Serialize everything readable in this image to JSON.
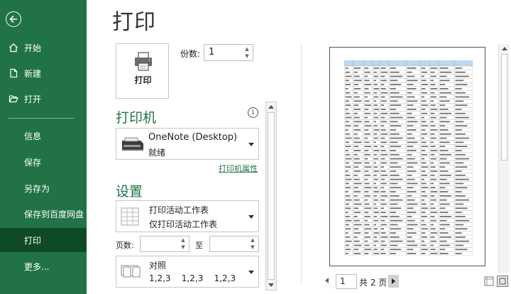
{
  "sidebar": {
    "items": [
      {
        "label": "开始",
        "icon": "home-icon"
      },
      {
        "label": "新建",
        "icon": "new-document-icon"
      },
      {
        "label": "打开",
        "icon": "folder-open-icon"
      },
      {
        "label": "信息"
      },
      {
        "label": "保存"
      },
      {
        "label": "另存为"
      },
      {
        "label": "保存到百度网盘"
      },
      {
        "label": "打印",
        "active": true
      },
      {
        "label": "更多..."
      }
    ]
  },
  "main": {
    "title": "打印",
    "print_button": {
      "label": "打印",
      "icon": "printer-icon"
    },
    "copies": {
      "label": "份数:",
      "value": "1"
    },
    "printer_section": {
      "heading": "打印机",
      "name": "OneNote (Desktop)",
      "status": "就绪",
      "properties_link": "打印机属性"
    },
    "settings_section": {
      "heading": "设置",
      "scope": {
        "line1": "打印活动工作表",
        "line2": "仅打印活动工作表"
      },
      "pages_label": "页数:",
      "pages_to": "至",
      "collate": {
        "line1": "对照",
        "line2": "1,2,3    1,2,3    1,2,3"
      }
    },
    "preview": {
      "current_page": "1",
      "total_pages": "共 2 页"
    }
  },
  "colors": {
    "sidebar": "#217346",
    "sidebar_active": "#0e4a26",
    "accent": "#217346",
    "table_header": "#bdd7ee"
  }
}
